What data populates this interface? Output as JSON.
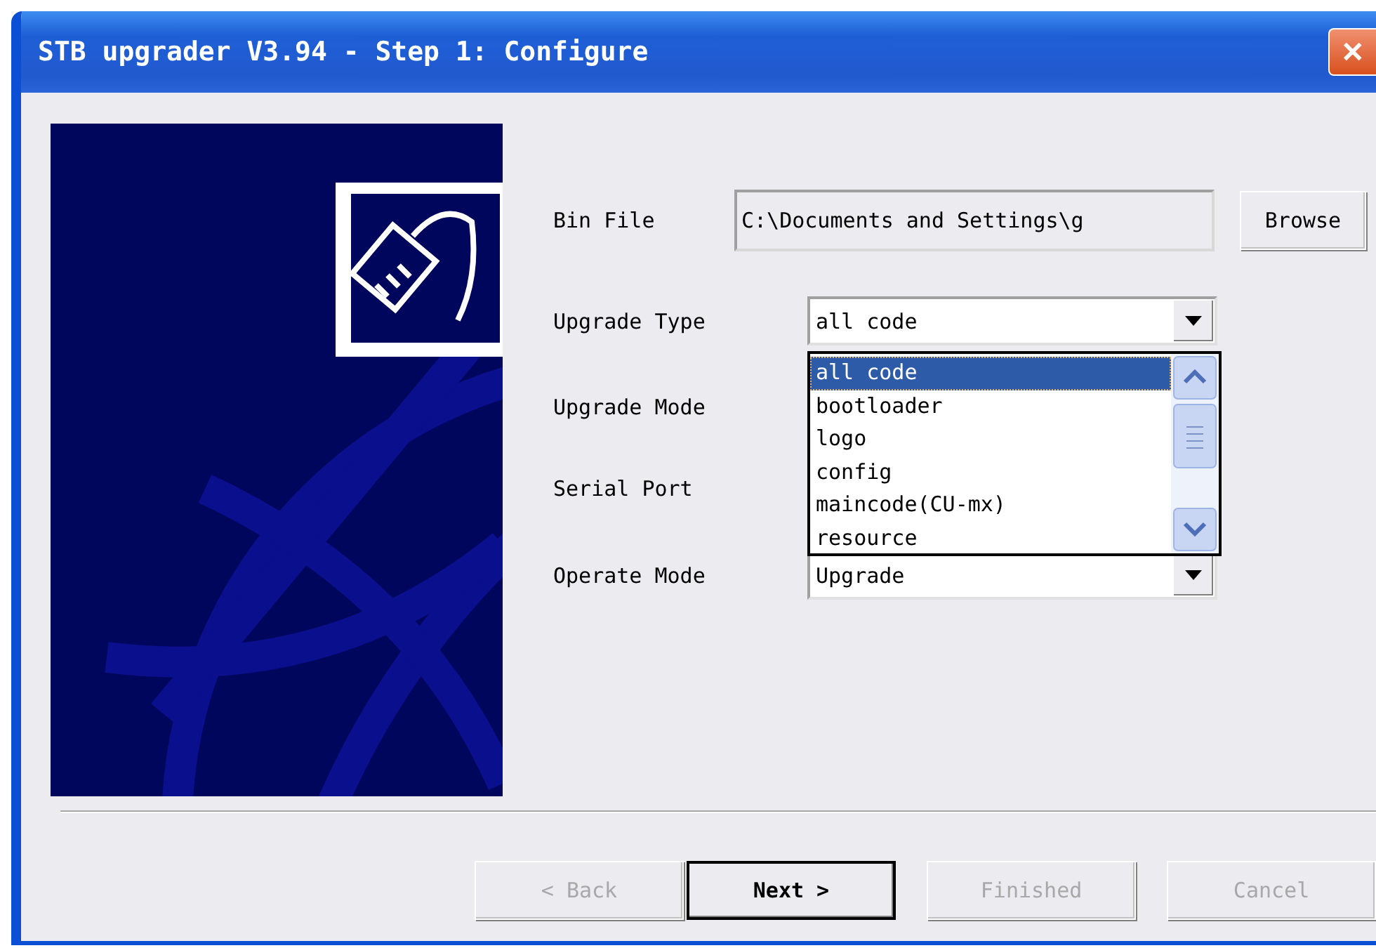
{
  "window": {
    "title": "STB upgrader V3.94 - Step 1: Configure",
    "close": "✕"
  },
  "bin_file": {
    "label": "Bin File",
    "value": "C:\\Documents and Settings\\g"
  },
  "browse": "Browse",
  "upgrade_type": {
    "label": "Upgrade Type",
    "value": "all code",
    "list": [
      {
        "label": "all code",
        "selected": true
      },
      {
        "label": "bootloader",
        "selected": false
      },
      {
        "label": "logo",
        "selected": false
      },
      {
        "label": "config",
        "selected": false
      },
      {
        "label": "maincode(CU-mx)",
        "selected": false
      },
      {
        "label": "resource",
        "selected": false
      }
    ]
  },
  "upgrade_mode": {
    "label": "Upgrade Mode"
  },
  "serial_port": {
    "label": "Serial Port"
  },
  "operate_mode": {
    "label": "Operate Mode",
    "value": "Upgrade"
  },
  "buttons": [
    {
      "label": "< Back",
      "disabled": true,
      "default": false
    },
    {
      "label": "Next >",
      "disabled": false,
      "default": true
    },
    {
      "label": "Finished",
      "disabled": true,
      "default": false
    },
    {
      "label": "Cancel",
      "disabled": true,
      "default": false
    }
  ]
}
